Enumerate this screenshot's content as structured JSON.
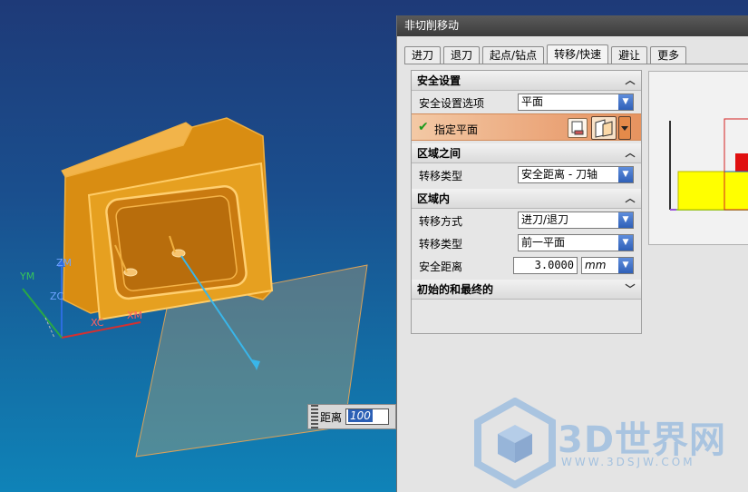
{
  "viewport": {
    "axes": {
      "ym": "YM",
      "zm": "ZM",
      "zc": "ZC",
      "xc": "XC",
      "xm": "XM"
    },
    "distance_label": "距离",
    "distance_value": "100"
  },
  "dialog": {
    "title": "非切削移动",
    "tabs": [
      "进刀",
      "退刀",
      "起点/钻点",
      "转移/快速",
      "避让",
      "更多"
    ],
    "active_tab": "转移/快速",
    "safety": {
      "header": "安全设置",
      "option_label": "安全设置选项",
      "option_value": "平面",
      "specify_plane_label": "指定平面"
    },
    "between_regions": {
      "header": "区域之间",
      "transfer_type_label": "转移类型",
      "transfer_type_value": "安全距离 - 刀轴"
    },
    "within_region": {
      "header": "区域内",
      "transfer_method_label": "转移方式",
      "transfer_method_value": "进刀/退刀",
      "transfer_type_label": "转移类型",
      "transfer_type_value": "前一平面",
      "safe_distance_label": "安全距离",
      "safe_distance_value": "3.0000",
      "safe_distance_unit": "mm"
    },
    "initial_final": {
      "header": "初始的和最终的"
    }
  },
  "watermark": {
    "text": "3D世界网",
    "url": "WWW.3DSJW.COM"
  },
  "colors": {
    "accent": "#2f60b8",
    "highlight": "#e6935f",
    "part": "#e8a21a",
    "check": "#1c9a1c"
  }
}
